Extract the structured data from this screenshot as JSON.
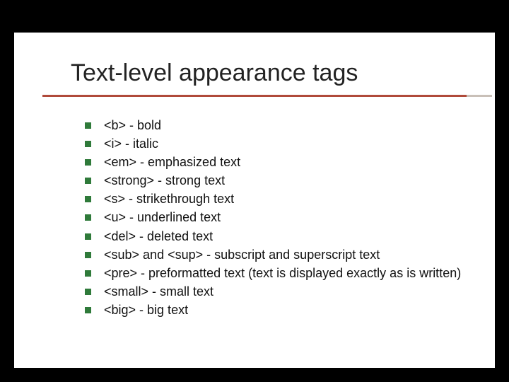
{
  "slide": {
    "title": "Text-level appearance tags",
    "bullets": [
      "<b> - bold",
      "<i> - italic",
      "<em> - emphasized text",
      "<strong> - strong text",
      "<s> - strikethrough text",
      "<u> - underlined text",
      "<del> - deleted text",
      "<sub> and <sup> - subscript and superscript text",
      "<pre> - preformatted text (text is displayed exactly as is written)",
      "<small> - small text",
      "<big> - big text"
    ]
  },
  "colors": {
    "accent_line": "#b04a3a",
    "bullet": "#2f7a3a"
  }
}
